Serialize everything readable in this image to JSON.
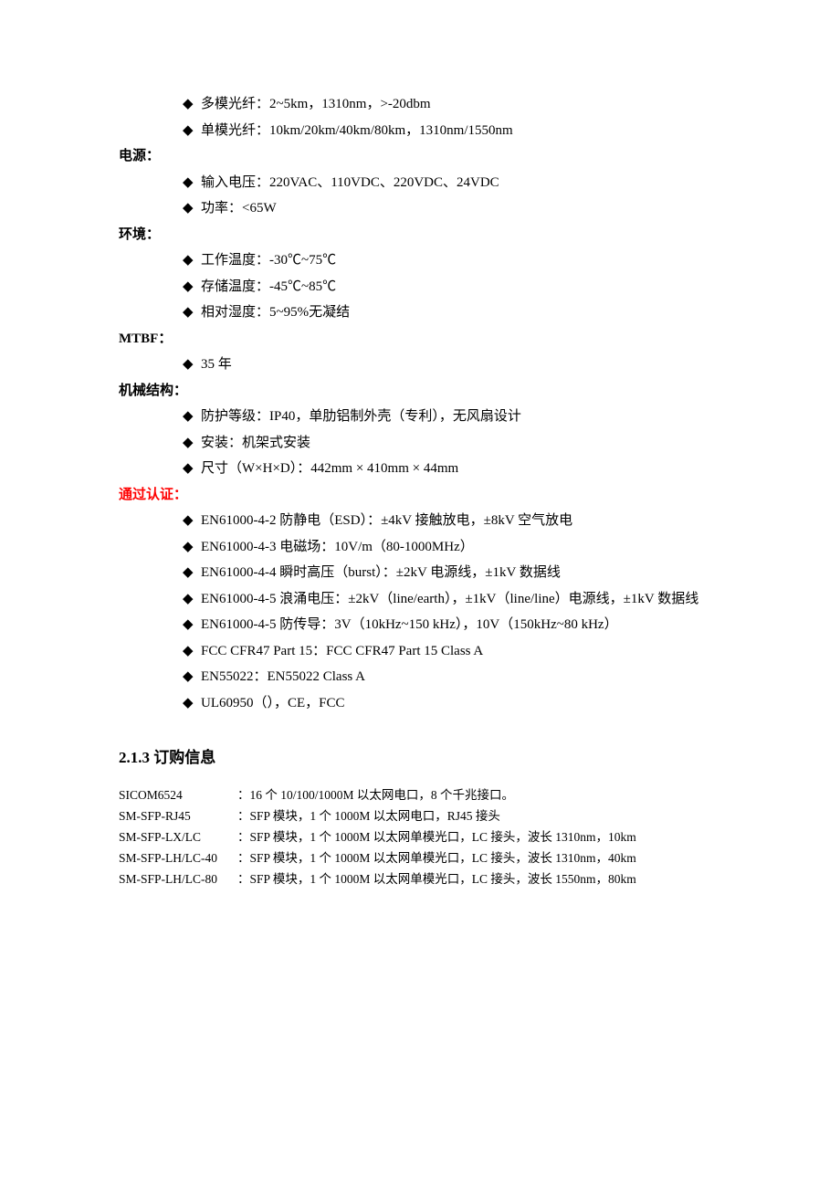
{
  "sections": [
    {
      "title_key": "s0",
      "title": "",
      "red": false,
      "items": [
        "多模光纤：2~5km，1310nm，>-20dbm",
        "单模光纤：10km/20km/40km/80km，1310nm/1550nm"
      ]
    },
    {
      "title_key": "s1",
      "title": "电源：",
      "red": false,
      "items": [
        "输入电压：220VAC、110VDC、220VDC、24VDC",
        "功率：<65W"
      ]
    },
    {
      "title_key": "s2",
      "title": "环境：",
      "red": false,
      "items": [
        "工作温度：-30℃~75℃",
        "存储温度：-45℃~85℃",
        "相对湿度：5~95%无凝结"
      ]
    },
    {
      "title_key": "s3",
      "title": "MTBF：",
      "red": false,
      "items": [
        "35 年"
      ]
    },
    {
      "title_key": "s4",
      "title": "机械结构：",
      "red": false,
      "items": [
        "防护等级：IP40，单肋铝制外壳（专利），无风扇设计",
        "安装：机架式安装",
        "尺寸（W×H×D）：442mm × 410mm × 44mm"
      ]
    },
    {
      "title_key": "s5",
      "title": "通过认证：",
      "red": true,
      "items": [
        "EN61000-4-2 防静电（ESD）：±4kV 接触放电，±8kV 空气放电",
        "EN61000-4-3 电磁场：10V/m（80-1000MHz）",
        "EN61000-4-4 瞬时高压（burst）：±2kV 电源线，±1kV 数据线",
        "EN61000-4-5 浪涌电压：±2kV（line/earth），±1kV（line/line）电源线，±1kV 数据线",
        "EN61000-4-5 防传导：3V（10kHz~150 kHz），10V（150kHz~80 kHz）",
        "FCC CFR47 Part 15：FCC CFR47 Part 15 Class A",
        "EN55022：EN55022 Class A",
        "UL60950（），CE，FCC"
      ]
    }
  ],
  "heading": "2.1.3 订购信息",
  "orders": [
    {
      "code": "SICOM6524",
      "sep": "：",
      "desc": "16 个 10/100/1000M 以太网电口，8 个千兆接口。"
    },
    {
      "code": "SM-SFP-RJ45",
      "sep": "：",
      "desc": "SFP 模块，1 个 1000M 以太网电口，RJ45 接头"
    },
    {
      "code": "SM-SFP-LX/LC",
      "sep": "：",
      "desc": "SFP 模块，1 个 1000M 以太网单模光口，LC 接头，波长 1310nm，10km"
    },
    {
      "code": "SM-SFP-LH/LC-40",
      "sep": "：",
      "desc": "SFP 模块，1 个 1000M 以太网单模光口，LC 接头，波长 1310nm，40km"
    },
    {
      "code": "SM-SFP-LH/LC-80",
      "sep": "：",
      "desc": "SFP 模块，1 个 1000M 以太网单模光口，LC 接头，波长 1550nm，80km"
    }
  ],
  "diamond": "◆"
}
